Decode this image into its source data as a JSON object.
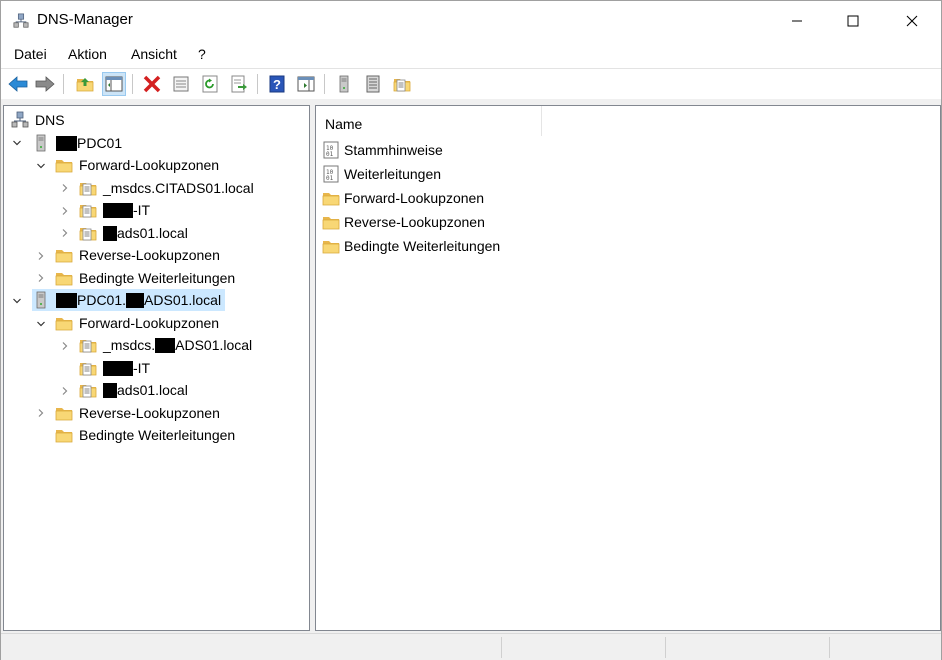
{
  "window": {
    "title": "DNS-Manager"
  },
  "menu": [
    {
      "label": "Datei"
    },
    {
      "label": "Aktion"
    },
    {
      "label": "Ansicht"
    },
    {
      "label": "?"
    }
  ],
  "toolbar": {
    "buttons": [
      "back-arrow-icon",
      "forward-arrow-icon",
      "up-folder-icon",
      "show-hide-tree-icon",
      "delete-icon",
      "properties-icon",
      "refresh-icon",
      "export-list-icon",
      "help-icon",
      "action-pane-icon",
      "server-icon",
      "list-icon",
      "zone-icon"
    ]
  },
  "tree": {
    "root": "DNS",
    "server1": {
      "name_suffix": "PDC01",
      "forward": "Forward-Lookupzonen",
      "zone_msdcs": "_msdcs.CITADS01.local",
      "zone_it_suffix": "-IT",
      "zone_ads_suffix": "ads01.local",
      "reverse": "Reverse-Lookupzonen",
      "conditional": "Bedingte Weiterleitungen"
    },
    "server2": {
      "name_part1": "PDC01.",
      "name_part2": "ADS01.local",
      "forward": "Forward-Lookupzonen",
      "zone_msdcs_prefix": "_msdcs.",
      "zone_msdcs_suffix": "ADS01.local",
      "zone_it_suffix": "-IT",
      "zone_ads_suffix": "ads01.local",
      "reverse": "Reverse-Lookupzonen",
      "conditional": "Bedingte Weiterleitungen"
    }
  },
  "list": {
    "column_name": "Name",
    "items": [
      {
        "label": "Stammhinweise",
        "icon": "root-hints-icon"
      },
      {
        "label": "Weiterleitungen",
        "icon": "forwarders-icon"
      },
      {
        "label": "Forward-Lookupzonen",
        "icon": "folder-icon"
      },
      {
        "label": "Reverse-Lookupzonen",
        "icon": "folder-icon"
      },
      {
        "label": "Bedingte Weiterleitungen",
        "icon": "folder-icon"
      }
    ]
  },
  "colors": {
    "selection": "#cce8ff",
    "folder": "#f8d775",
    "accent": "#0078d7"
  }
}
